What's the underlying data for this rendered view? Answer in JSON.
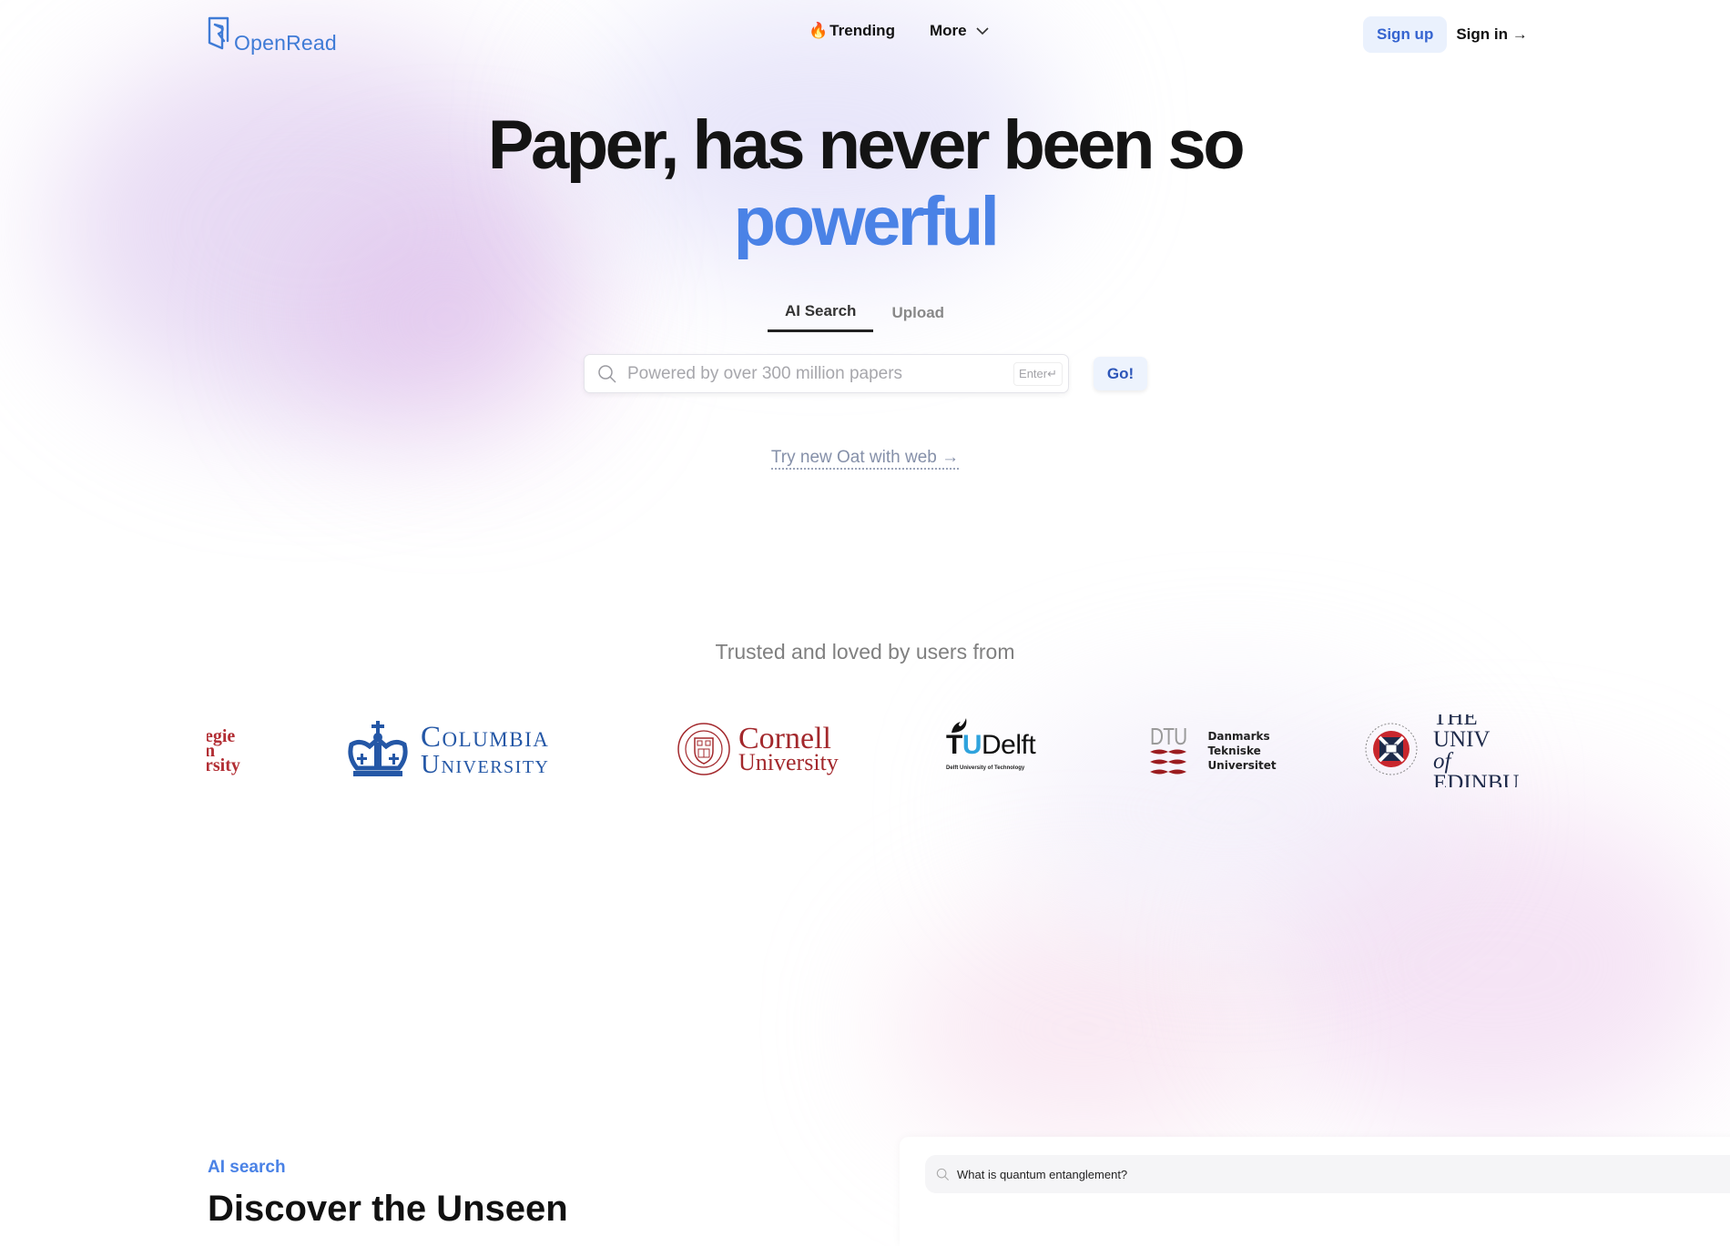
{
  "header": {
    "brand": "OpenRead",
    "nav": [
      {
        "icon": "fire-icon",
        "emoji": "🔥",
        "label": "Trending"
      },
      {
        "label": "More",
        "icon": "chevron-down-icon"
      }
    ],
    "signup_label": "Sign up",
    "signin_label": "Sign in →"
  },
  "hero": {
    "title_line1": "Paper, has never been so",
    "title_line2": "powerful",
    "accent_color": "#4a82e6"
  },
  "tabs": [
    {
      "label": "AI Search",
      "active": true
    },
    {
      "label": "Upload",
      "active": false
    }
  ],
  "search": {
    "placeholder": "Powered by over 300 million papers",
    "value": "",
    "enter_hint": "Enter↵",
    "go_label": "Go!"
  },
  "try_link": "Try new Oat with web →",
  "trusted": {
    "heading": "Trusted and loved by users from",
    "logos": [
      {
        "name": "Carnegie Mellon University",
        "visible_lines": [
          "egie",
          "n",
          "rsity"
        ]
      },
      {
        "name": "Columbia University",
        "line1": "Columbia",
        "line2": "University"
      },
      {
        "name": "Cornell University",
        "line1": "Cornell",
        "line2": "University"
      },
      {
        "name": "TU Delft",
        "t": "T",
        "u": "U",
        "rest": "Delft",
        "sub": "Delft University of Technology"
      },
      {
        "name": "DTU",
        "mark": "DTU",
        "lines": [
          "Danmarks",
          "Tekniske",
          "Universitet"
        ]
      },
      {
        "name": "The University of Edinburgh",
        "line1": "THE UNIV",
        "line2_of": "of",
        "line2": " EDINBU"
      }
    ]
  },
  "ai_section": {
    "label": "AI search",
    "heading": "Discover the Unseen",
    "demo_query": "What is quantum entanglement?"
  }
}
